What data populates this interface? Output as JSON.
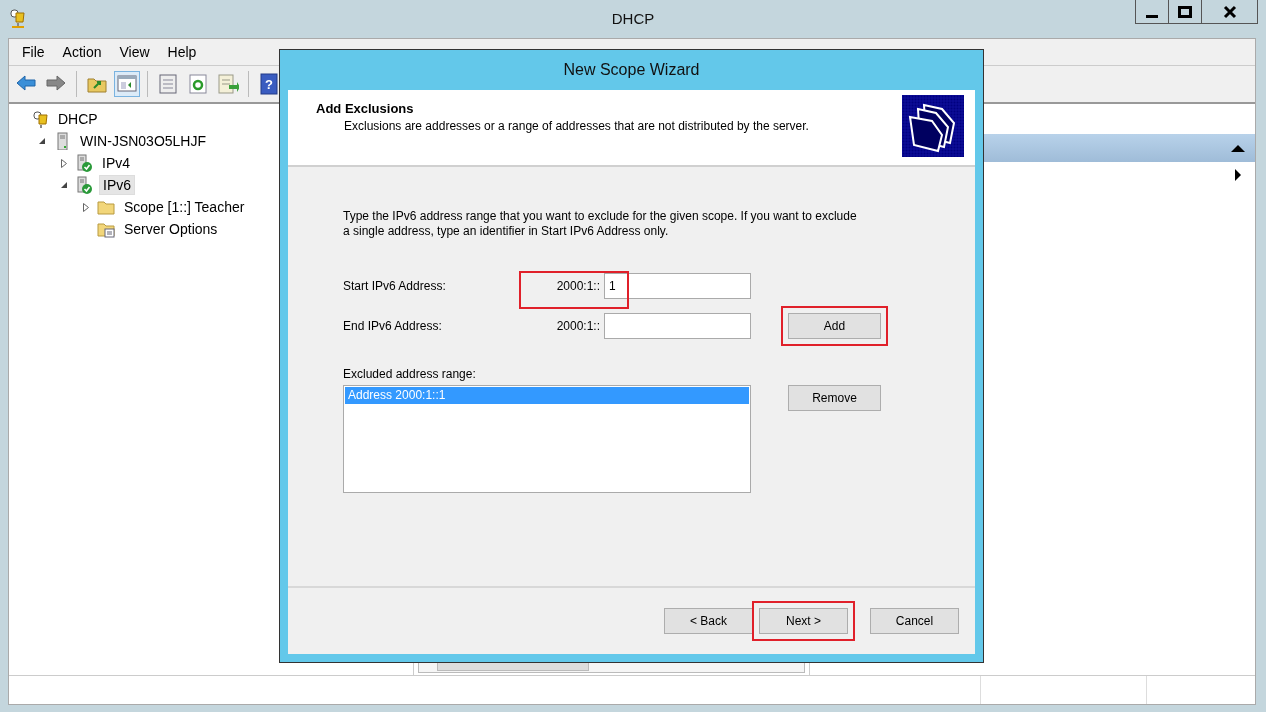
{
  "window": {
    "title": "DHCP"
  },
  "menu": [
    "File",
    "Action",
    "View",
    "Help"
  ],
  "toolbar": [
    {
      "kind": "back"
    },
    {
      "kind": "forward"
    },
    {
      "kind": "sep"
    },
    {
      "kind": "up"
    },
    {
      "kind": "pane",
      "selected": true
    },
    {
      "kind": "sep"
    },
    {
      "kind": "props"
    },
    {
      "kind": "refresh"
    },
    {
      "kind": "export"
    },
    {
      "kind": "sep"
    },
    {
      "kind": "help",
      "glyph": "?"
    }
  ],
  "tree": [
    {
      "label": "DHCP",
      "kind": "dhcp",
      "selected": false,
      "children": [
        {
          "label": "WIN-JSN03O5LHJF",
          "kind": "server",
          "expanded": true,
          "selected": false,
          "children": [
            {
              "label": "IPv4",
              "kind": "protocol",
              "expanded": false,
              "selected": false
            },
            {
              "label": "IPv6",
              "kind": "protocol",
              "expanded": true,
              "selected": true,
              "children": [
                {
                  "label": "Scope [1::] Teacher",
                  "kind": "folder",
                  "expanded": false,
                  "selected": false
                },
                {
                  "label": "Server Options",
                  "kind": "options",
                  "selected": false
                }
              ]
            }
          ]
        }
      ]
    }
  ],
  "wizard": {
    "title": "New Scope Wizard",
    "header": {
      "title": "Add Exclusions",
      "subtitle": "Exclusions are addresses or a range of addresses that are not distributed by the server."
    },
    "instructions": "Type the IPv6 address range that you want to exclude for the given scope. If you want to exclude a single address, type an identifier in Start IPv6 Address only.",
    "fields": [
      {
        "label": "Start IPv6 Address:",
        "prefix": "2000:1::",
        "value": "1",
        "highlighted": true
      },
      {
        "label": "End IPv6 Address:",
        "prefix": "2000:1::",
        "highlighted": false
      }
    ],
    "add_button": {
      "label": "Add",
      "highlighted": true
    },
    "list": {
      "label": "Excluded address range:",
      "items": [
        {
          "text": "Address 2000:1::1",
          "selected": true
        }
      ]
    },
    "remove_button": {
      "label": "Remove",
      "highlighted": false
    },
    "buttons": [
      {
        "label": "< Back",
        "highlighted": false
      },
      {
        "label": "Next >",
        "highlighted": true
      },
      {
        "label": "Cancel",
        "highlighted": false
      }
    ]
  }
}
